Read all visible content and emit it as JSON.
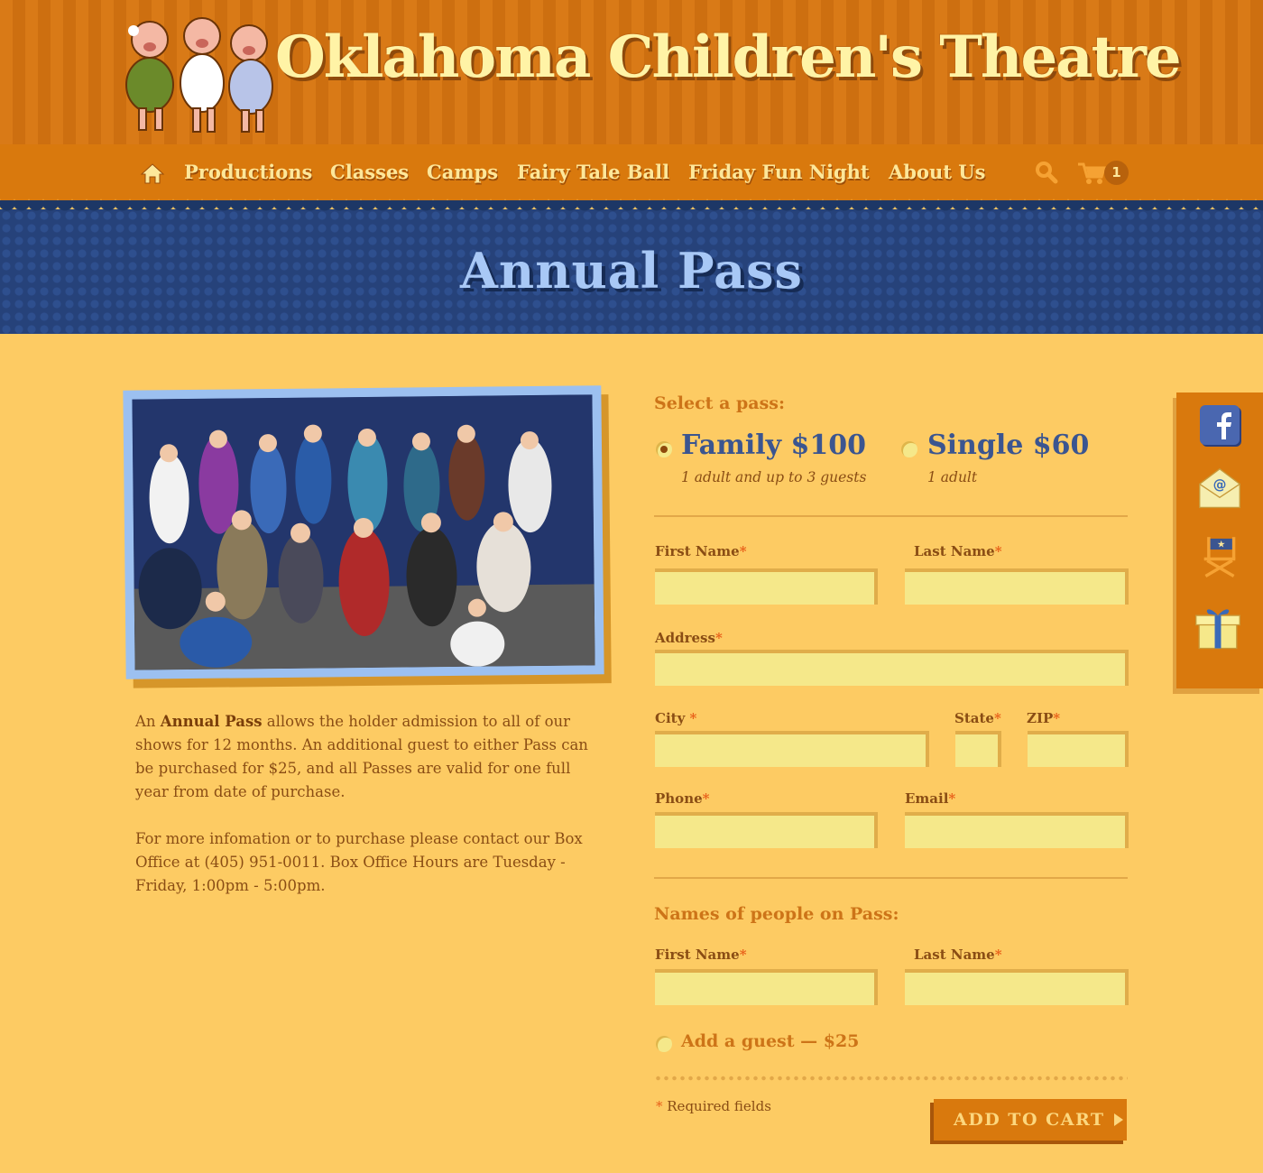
{
  "brand": {
    "logo_text": "Oklahoma Children's Theatre"
  },
  "nav": {
    "items": [
      "Productions",
      "Classes",
      "Camps",
      "Fairy Tale Ball",
      "Friday Fun Night",
      "About Us"
    ],
    "cart_count": "1"
  },
  "page": {
    "title": "Annual Pass"
  },
  "description": {
    "p1_pre": "An ",
    "p1_bold": "Annual Pass",
    "p1_post": " allows the holder admission to all of our shows for 12 months. An additional guest to either Pass can be purchased for $25, and all Passes are valid for one full year from date of purchase.",
    "p2": "For more infomation or to purchase please contact our Box Office at (405) 951-0011. Box Office Hours are Tuesday - Friday, 1:00pm - 5:00pm."
  },
  "form": {
    "select_heading": "Select a pass:",
    "passes": [
      {
        "name": "Family $100",
        "sub": "1 adult and up to 3 guests",
        "selected": true
      },
      {
        "name": "Single $60",
        "sub": "1 adult",
        "selected": false
      }
    ],
    "labels": {
      "first_name": "First Name",
      "last_name": "Last Name",
      "address": "Address",
      "city": "City",
      "state": "State",
      "zip": "ZIP",
      "phone": "Phone",
      "email": "Email"
    },
    "required_mark": "*",
    "names_heading": "Names of people on Pass:",
    "add_guest": "Add a guest — $25",
    "required_note": " Required fields",
    "submit": "ADD TO CART"
  },
  "colors": {
    "accent": "#d9790d",
    "banner": "#26427a",
    "background": "#fdcb63",
    "title": "#a8c8f6"
  },
  "social": [
    "facebook-icon",
    "email-icon",
    "director-chair-icon",
    "gift-icon"
  ]
}
